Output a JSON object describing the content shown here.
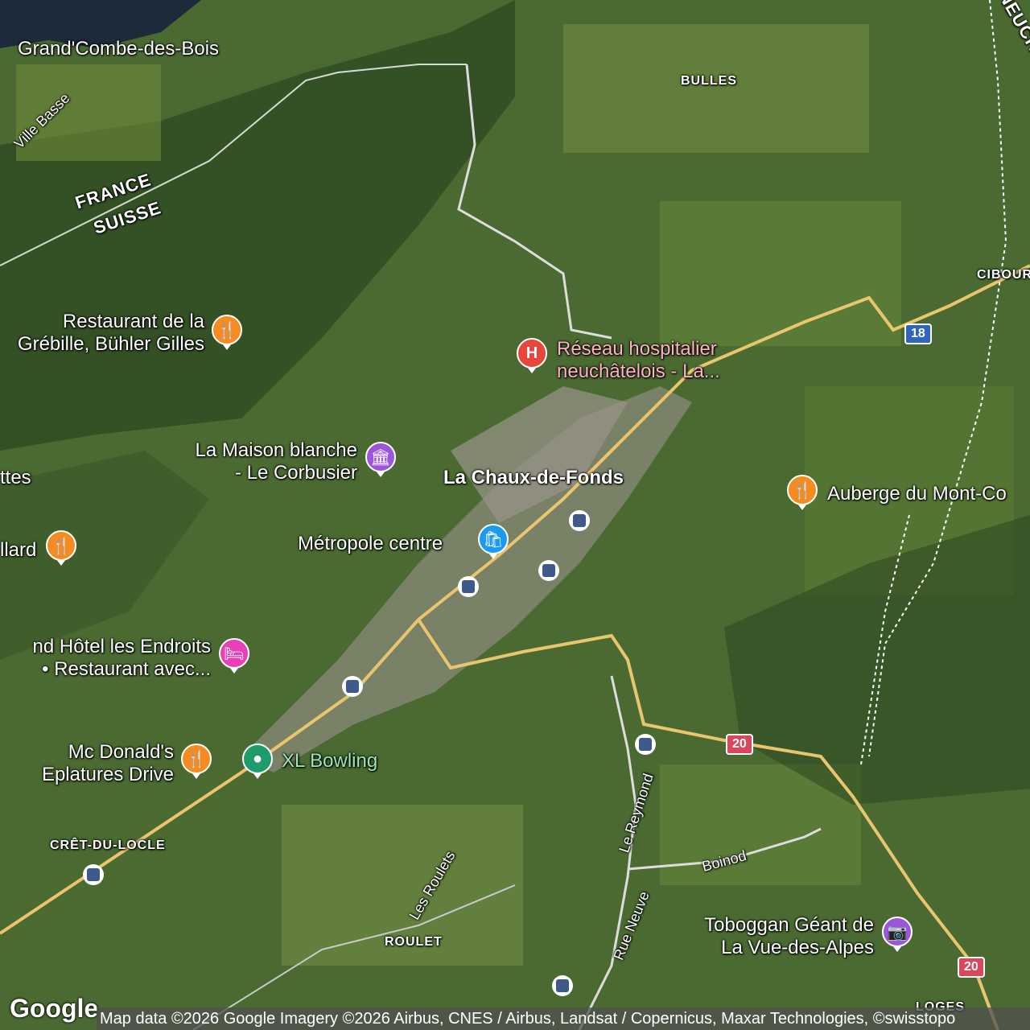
{
  "map": {
    "places": {
      "grand_combe": "Grand'Combe-des-Bois",
      "ville_basse": "Ville Basse",
      "france": "FRANCE",
      "suisse": "SUISSE",
      "bulles": "BULLES",
      "neuchatel": "NEUCHÂTEL",
      "ciboure": "CIBOURG",
      "la_chaux": "La Chaux-de-Fonds",
      "ttes": "ttes",
      "cret_du_locle": "CRÊT-DU-LOCLE",
      "roulet": "ROULET",
      "les_roulets": "Les Roulets",
      "le_reymond": "Le Reymond",
      "rue_neuve": "Rue Neuve",
      "boinod": "Boinod",
      "loges": "LOGES"
    },
    "pois": {
      "restaurant_grebille_1": "Restaurant de la",
      "restaurant_grebille_2": "Grébille, Bühler Gilles",
      "hospital_1": "Réseau hospitalier",
      "hospital_2": "neuchâtelois - La...",
      "maison_blanche_1": "La Maison blanche",
      "maison_blanche_2": "- Le Corbusier",
      "auberge": "Auberge du Mont-Co",
      "metropole": "Métropole centre",
      "llard": "llard",
      "hotel_1": "nd Hôtel les Endroits",
      "hotel_2": "• Restaurant avec...",
      "mcdonalds_1": "Mc Donald's",
      "mcdonalds_2": "Eplatures Drive",
      "bowling": "XL Bowling",
      "toboggan_1": "Toboggan Géant de",
      "toboggan_2": "La Vue-des-Alpes"
    },
    "shields": {
      "r18": "18",
      "r20a": "20",
      "r20b": "20"
    },
    "logo": "Google",
    "attribution": "Map data ©2026 Google Imagery ©2026 Airbus, CNES / Airbus, Landsat / Copernicus, Maxar Technologies, ©swisstopo"
  }
}
